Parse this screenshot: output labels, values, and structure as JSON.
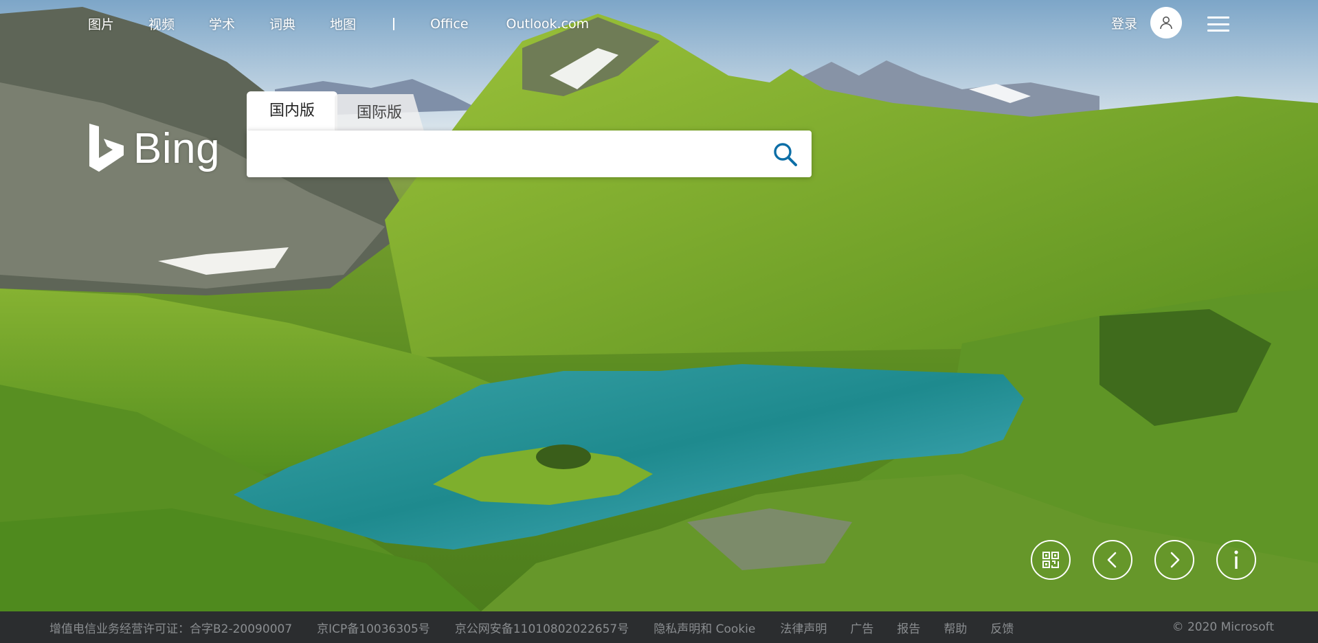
{
  "nav": {
    "links": [
      "图片",
      "视频",
      "学术",
      "词典",
      "地图"
    ],
    "extra_links": [
      "Office",
      "Outlook.com"
    ],
    "login_label": "登录"
  },
  "logo": {
    "text": "Bing"
  },
  "search": {
    "tabs": [
      "国内版",
      "国际版"
    ],
    "active_tab": "国内版",
    "value": "",
    "placeholder": ""
  },
  "controls": [
    "qr-code-icon",
    "previous-icon",
    "next-icon",
    "info-icon"
  ],
  "footer": {
    "links": [
      "增值电信业务经营许可证：合字B2-20090007",
      "京ICP备10036305号",
      "京公网安备11010802022657号",
      "隐私声明和 Cookie",
      "法律声明",
      "广告",
      "报告",
      "帮助",
      "反馈"
    ],
    "copyright": "© 2020 Microsoft"
  },
  "colors": {
    "search_icon": "#0c6ea6",
    "footer_bg": "#2b2d2f",
    "footer_text": "#8a8d90"
  }
}
